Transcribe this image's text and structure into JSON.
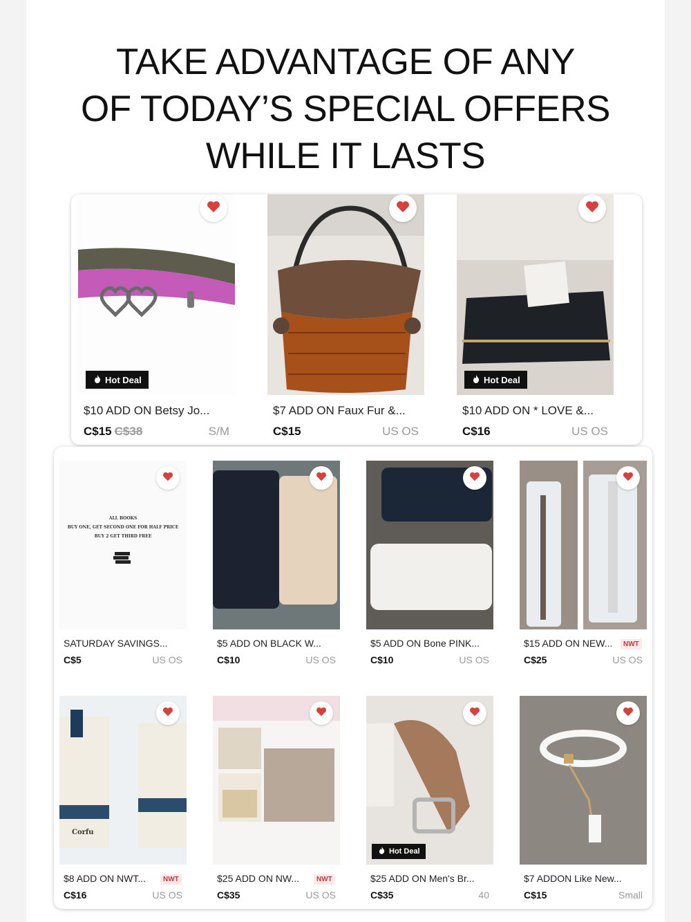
{
  "headline": {
    "line1": "TAKE ADVANTAGE OF ANY",
    "line2": "OF TODAY’S SPECIAL OFFERS",
    "line3": "WHILE IT LASTS"
  },
  "colors": {
    "heart": "#d6403d",
    "nwt_bg": "#fde8ea",
    "nwt_text": "#c2383d",
    "badge_bg": "#111111"
  },
  "top_items": [
    {
      "title": "$10 ADD ON Betsy Jo...",
      "price": "C$15",
      "original_price": "C$38",
      "meta": "S/M",
      "badge": "Hot Deal",
      "icon": "heart-icon"
    },
    {
      "title": "$7 ADD ON Faux Fur &...",
      "price": "C$15",
      "meta": "US OS",
      "icon": "heart-icon"
    },
    {
      "title": "$10 ADD ON * LOVE &...",
      "price": "C$16",
      "meta": "US OS",
      "badge": "Hot Deal",
      "icon": "heart-icon"
    }
  ],
  "grid_items": [
    {
      "title": "SATURDAY SAVINGS...",
      "price": "C$5",
      "meta": "US OS",
      "image_text": [
        "ALL BOOKS",
        "BUY ONE, GET SECOND ONE FOR HALF PRICE",
        "BUY 2 GET THIRD FREE"
      ]
    },
    {
      "title": "$5 ADD ON BLACK  W...",
      "price": "C$10",
      "meta": "US OS"
    },
    {
      "title": "$5 ADD ON Bone PINK...",
      "price": "C$10",
      "meta": "US OS"
    },
    {
      "title": "$15 ADD ON NEW...",
      "price": "C$25",
      "meta": "US OS",
      "tag": "NWT"
    },
    {
      "title": "$8 ADD ON NWT...",
      "price": "C$16",
      "meta": "US OS",
      "tag": "NWT",
      "image_text": [
        "Corfu"
      ]
    },
    {
      "title": "$25 ADD ON NW...",
      "price": "C$35",
      "meta": "US OS",
      "tag": "NWT"
    },
    {
      "title": "$25 ADD ON Men's Br...",
      "price": "C$35",
      "meta": "40",
      "badge": "Hot Deal"
    },
    {
      "title": "$7 ADDON Like New...",
      "price": "C$15",
      "meta": "Small"
    }
  ]
}
